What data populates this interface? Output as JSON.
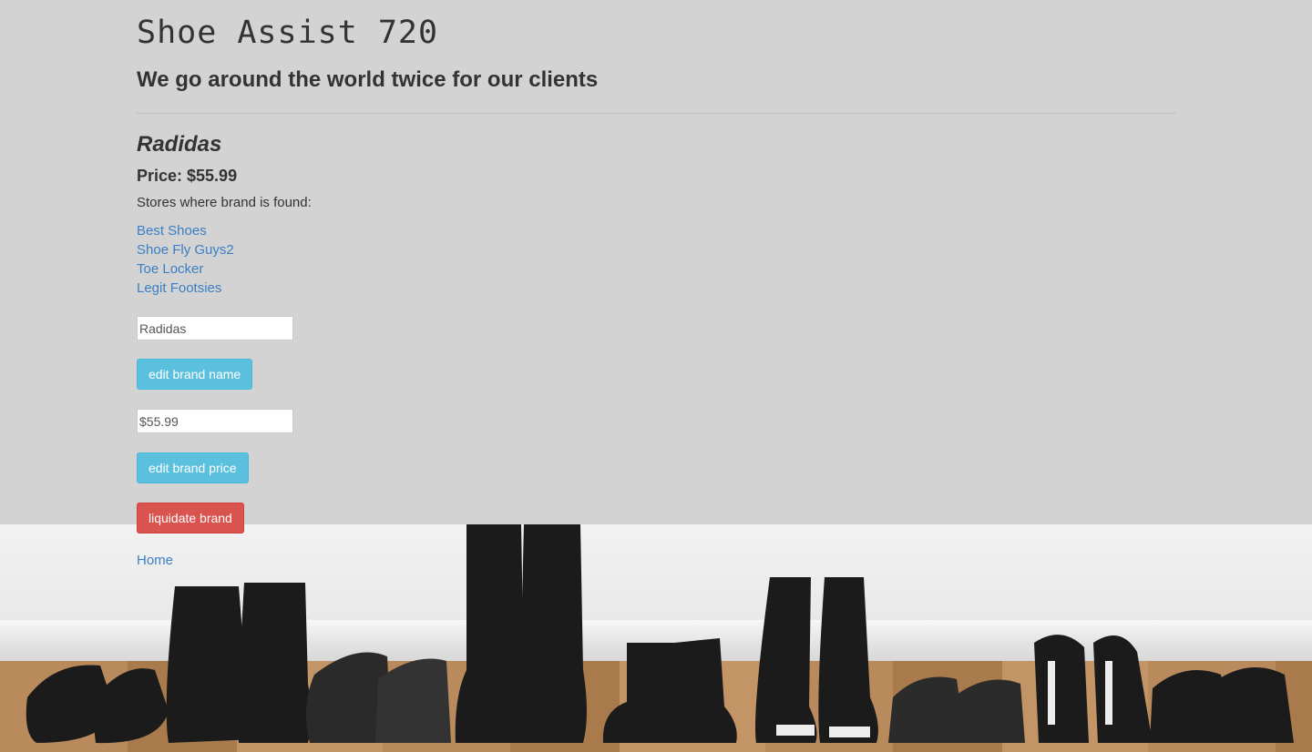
{
  "header": {
    "title": "Shoe Assist 720",
    "tagline": "We go around the world twice for our clients"
  },
  "brand": {
    "name": "Radidas",
    "price_label": "Price: $55.99",
    "stores_label": "Stores where brand is found:",
    "stores": [
      "Best Shoes",
      "Shoe Fly Guys2",
      "Toe Locker",
      "Legit Footsies"
    ]
  },
  "forms": {
    "name_value": "Radidas",
    "edit_name_label": "edit brand name",
    "price_value": "$55.99",
    "edit_price_label": "edit brand price",
    "liquidate_label": "liquidate brand"
  },
  "nav": {
    "home_label": "Home"
  },
  "colors": {
    "background": "#d3d3d3",
    "link": "#3a7fc4",
    "info_button": "#5bc0de",
    "danger_button": "#d9534f"
  }
}
